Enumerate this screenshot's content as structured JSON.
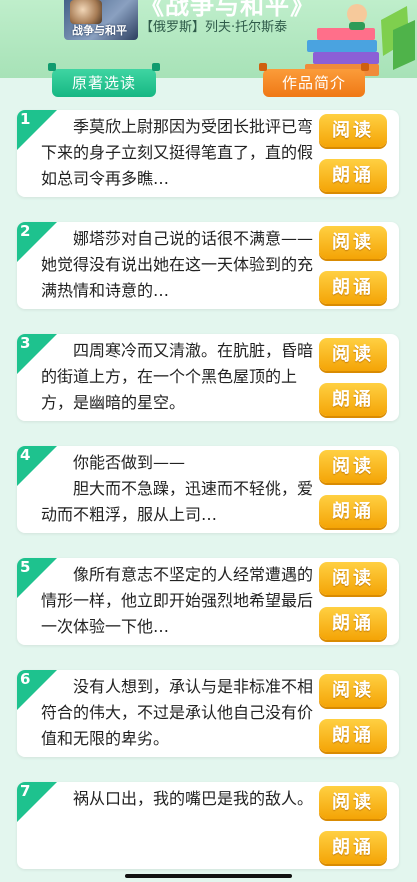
{
  "header": {
    "book_title_big": "《战争与和平》",
    "book_title_small": "战争与和平",
    "author": "【俄罗斯】列夫·托尔斯泰"
  },
  "tabs": [
    {
      "label": "原著选读",
      "active": true
    },
    {
      "label": "作品简介",
      "active": false
    }
  ],
  "buttons": {
    "read": "阅读",
    "listen": "朗诵"
  },
  "colors": {
    "accent_green": "#1ec28e",
    "accent_orange": "#f4a406",
    "background": "#e3f6ee"
  },
  "excerpts": [
    {
      "num": "1",
      "text": "　　季莫欣上尉那因为受团长批评已弯下来的身子立刻又挺得笔直了，直的假如总司令再多瞧…"
    },
    {
      "num": "2",
      "text": "　　娜塔莎对自己说的话很不满意——她觉得没有说出她在这一天体验到的充满热情和诗意的…"
    },
    {
      "num": "3",
      "text": "　　四周寒冷而又清澈。在肮脏，昏暗的街道上方，在一个个黑色屋顶的上方，是幽暗的星空。"
    },
    {
      "num": "4",
      "text": "　　你能否做到——\n　　胆大而不急躁，迅速而不轻佻，爱动而不粗浮，服从上司…"
    },
    {
      "num": "5",
      "text": "　　像所有意志不坚定的人经常遭遇的情形一样，他立即开始强烈地希望最后一次体验一下他…"
    },
    {
      "num": "6",
      "text": "　　没有人想到，承认与是非标准不相符合的伟大，不过是承认他自己没有价值和无限的卑劣。"
    },
    {
      "num": "7",
      "text": "　　祸从口出，我的嘴巴是我的敌人。"
    }
  ]
}
